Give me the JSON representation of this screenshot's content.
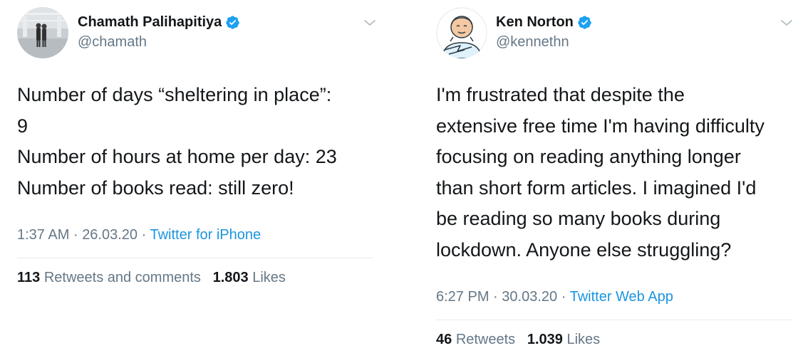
{
  "colors": {
    "text": "#14171a",
    "secondary": "#657786",
    "link": "#1b95e0",
    "verified": "#1da1f2",
    "divider": "#e6ecf0"
  },
  "tweets": [
    {
      "display_name": "Chamath Palihapitiya",
      "handle": "@chamath",
      "verified": true,
      "text_lines": [
        "Number of days “sheltering in place”:",
        "9",
        "Number of hours at home per day: 23",
        "Number of books read: still zero!"
      ],
      "time": "1:37 AM",
      "date": "26.03.20",
      "separator": "·",
      "source": "Twitter for iPhone",
      "retweets_count": "113",
      "retweets_label": "Retweets and comments",
      "likes_count": "1.803",
      "likes_label": "Likes"
    },
    {
      "display_name": "Ken Norton",
      "handle": "@kennethn",
      "verified": true,
      "text_lines": [
        "I'm frustrated that despite the",
        "extensive free time I'm having difficulty",
        "focusing on reading anything longer",
        "than short form articles. I imagined I'd",
        "be reading so many books during",
        "lockdown. Anyone else struggling?"
      ],
      "time": "6:27 PM",
      "date": "30.03.20",
      "separator": "·",
      "source": "Twitter Web App",
      "retweets_count": "46",
      "retweets_label": "Retweets",
      "likes_count": "1.039",
      "likes_label": "Likes"
    }
  ]
}
